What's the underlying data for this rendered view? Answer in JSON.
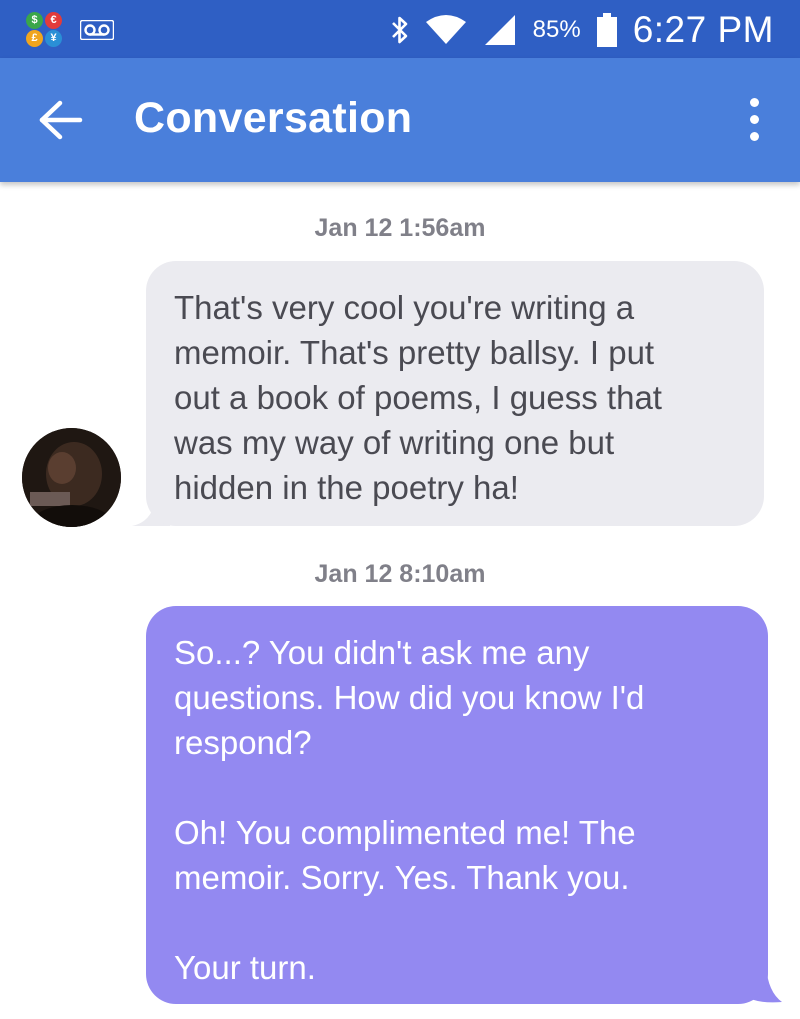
{
  "status_bar": {
    "battery": "85%",
    "time": "6:27 PM",
    "icons": [
      "currency-icon",
      "voicemail-icon",
      "bluetooth-icon",
      "wifi-icon",
      "signal-icon",
      "battery-icon"
    ]
  },
  "app_bar": {
    "title": "Conversation",
    "icons": [
      "back-arrow-icon",
      "overflow-menu-icon"
    ]
  },
  "messages": [
    {
      "timestamp": "Jan 12 1:56am",
      "direction": "incoming",
      "text": "That's very cool you're writing a\nmemoir. That's pretty ballsy. I put\nout a book of poems, I guess that\nwas my way of writing one but\nhidden in the poetry ha!"
    },
    {
      "timestamp": "Jan 12 8:10am",
      "direction": "outgoing",
      "text": "So...? You didn't ask me any\nquestions. How did you know I'd\nrespond?\n\nOh! You complimented me! The\nmemoir. Sorry. Yes. Thank you.\n\nYour turn."
    }
  ],
  "colors": {
    "status_bar": "#2f5fc4",
    "app_bar": "#4a7fdb",
    "incoming_bubble": "#ebebf0",
    "outgoing_bubble": "#9389f1",
    "timestamp_text": "#808089"
  }
}
